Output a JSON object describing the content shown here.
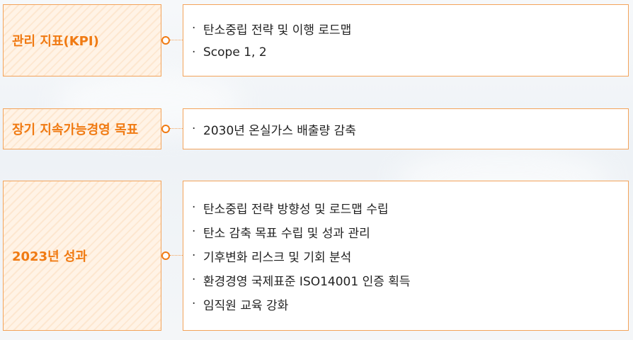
{
  "rows": [
    {
      "label": "관리 지표(KPI)",
      "items": [
        "탄소중립 전략 및 이행 로드맵",
        "Scope 1, 2"
      ]
    },
    {
      "label": "장기 지속가능경영 목표",
      "items": [
        "2030년 온실가스 배출량 감축"
      ]
    },
    {
      "label": "2023년 성과",
      "items": [
        "탄소중립 전략 방향성 및 로드맵 수립",
        "탄소 감축 목표 수립 및 성과 관리",
        "기후변화 리스크 및 기회 분석",
        "환경경영 국제표준 ISO14001 인증 획득",
        "임직원 교육 강화"
      ]
    }
  ],
  "bullet": "·",
  "colors": {
    "accent": "#f07a12",
    "border": "#f3a35a"
  }
}
